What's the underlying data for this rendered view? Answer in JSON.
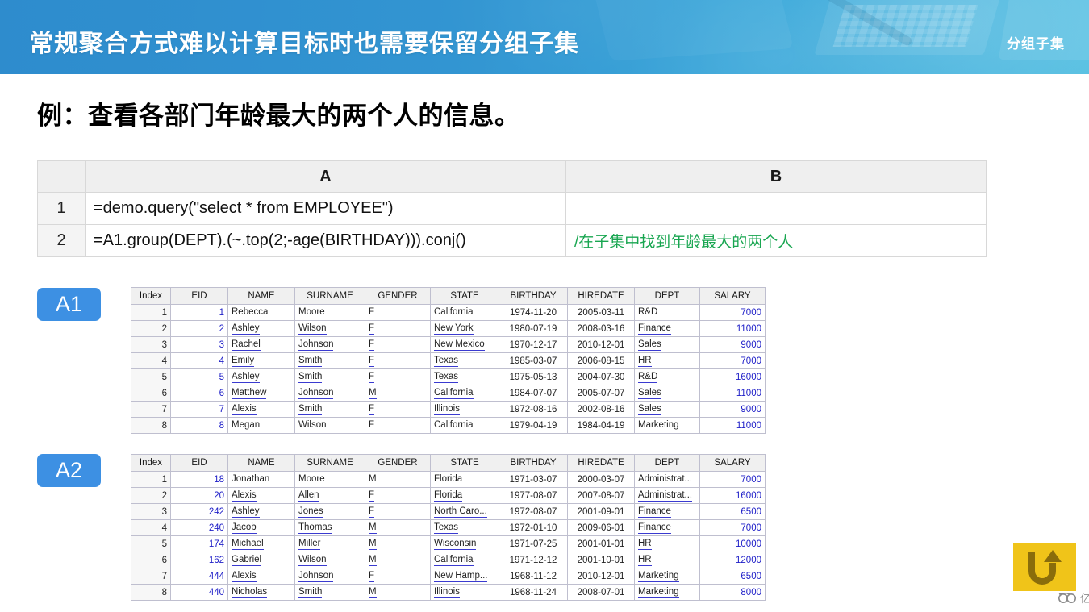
{
  "header": {
    "title": "常规聚合方式难以计算目标时也需要保留分组子集",
    "tag": "分组子集",
    "bg_color": "#2e92cf",
    "text_color": "#ffffff"
  },
  "subtitle": "例：查看各部门年龄最大的两个人的信息。",
  "code_table": {
    "corner_label": "",
    "columns": [
      "A",
      "B"
    ],
    "rows": [
      {
        "num": "1",
        "a": "=demo.query(\"select * from EMPLOYEE\")",
        "b": ""
      },
      {
        "num": "2",
        "a": "=A1.group(DEPT).(~.top(2;-age(BIRTHDAY))).conj()",
        "b": "/在子集中找到年龄最大的两个人"
      }
    ],
    "comment_color": "#19a651"
  },
  "results": [
    {
      "badge": "A1",
      "badge_color": "#3d90e3",
      "columns": [
        "Index",
        "EID",
        "NAME",
        "SURNAME",
        "GENDER",
        "STATE",
        "BIRTHDAY",
        "HIREDATE",
        "DEPT",
        "SALARY"
      ],
      "rows": [
        {
          "index": "1",
          "eid": "1",
          "name": "Rebecca",
          "surname": "Moore",
          "gender": "F",
          "state": "California",
          "birthday": "1974-11-20",
          "hiredate": "2005-03-11",
          "dept": "R&D",
          "salary": "7000"
        },
        {
          "index": "2",
          "eid": "2",
          "name": "Ashley",
          "surname": "Wilson",
          "gender": "F",
          "state": "New York",
          "birthday": "1980-07-19",
          "hiredate": "2008-03-16",
          "dept": "Finance",
          "salary": "11000"
        },
        {
          "index": "3",
          "eid": "3",
          "name": "Rachel",
          "surname": "Johnson",
          "gender": "F",
          "state": "New Mexico",
          "birthday": "1970-12-17",
          "hiredate": "2010-12-01",
          "dept": "Sales",
          "salary": "9000"
        },
        {
          "index": "4",
          "eid": "4",
          "name": "Emily",
          "surname": "Smith",
          "gender": "F",
          "state": "Texas",
          "birthday": "1985-03-07",
          "hiredate": "2006-08-15",
          "dept": "HR",
          "salary": "7000"
        },
        {
          "index": "5",
          "eid": "5",
          "name": "Ashley",
          "surname": "Smith",
          "gender": "F",
          "state": "Texas",
          "birthday": "1975-05-13",
          "hiredate": "2004-07-30",
          "dept": "R&D",
          "salary": "16000"
        },
        {
          "index": "6",
          "eid": "6",
          "name": "Matthew",
          "surname": "Johnson",
          "gender": "M",
          "state": "California",
          "birthday": "1984-07-07",
          "hiredate": "2005-07-07",
          "dept": "Sales",
          "salary": "11000"
        },
        {
          "index": "7",
          "eid": "7",
          "name": "Alexis",
          "surname": "Smith",
          "gender": "F",
          "state": "Illinois",
          "birthday": "1972-08-16",
          "hiredate": "2002-08-16",
          "dept": "Sales",
          "salary": "9000"
        },
        {
          "index": "8",
          "eid": "8",
          "name": "Megan",
          "surname": "Wilson",
          "gender": "F",
          "state": "California",
          "birthday": "1979-04-19",
          "hiredate": "1984-04-19",
          "dept": "Marketing",
          "salary": "11000"
        }
      ]
    },
    {
      "badge": "A2",
      "badge_color": "#3d90e3",
      "columns": [
        "Index",
        "EID",
        "NAME",
        "SURNAME",
        "GENDER",
        "STATE",
        "BIRTHDAY",
        "HIREDATE",
        "DEPT",
        "SALARY"
      ],
      "rows": [
        {
          "index": "1",
          "eid": "18",
          "name": "Jonathan",
          "surname": "Moore",
          "gender": "M",
          "state": "Florida",
          "birthday": "1971-03-07",
          "hiredate": "2000-03-07",
          "dept": "Administrat...",
          "salary": "7000"
        },
        {
          "index": "2",
          "eid": "20",
          "name": "Alexis",
          "surname": "Allen",
          "gender": "F",
          "state": "Florida",
          "birthday": "1977-08-07",
          "hiredate": "2007-08-07",
          "dept": "Administrat...",
          "salary": "16000"
        },
        {
          "index": "3",
          "eid": "242",
          "name": "Ashley",
          "surname": "Jones",
          "gender": "F",
          "state": "North Caro...",
          "birthday": "1972-08-07",
          "hiredate": "2001-09-01",
          "dept": "Finance",
          "salary": "6500"
        },
        {
          "index": "4",
          "eid": "240",
          "name": "Jacob",
          "surname": "Thomas",
          "gender": "M",
          "state": "Texas",
          "birthday": "1972-01-10",
          "hiredate": "2009-06-01",
          "dept": "Finance",
          "salary": "7000"
        },
        {
          "index": "5",
          "eid": "174",
          "name": "Michael",
          "surname": "Miller",
          "gender": "M",
          "state": "Wisconsin",
          "birthday": "1971-07-25",
          "hiredate": "2001-01-01",
          "dept": "HR",
          "salary": "10000"
        },
        {
          "index": "6",
          "eid": "162",
          "name": "Gabriel",
          "surname": "Wilson",
          "gender": "M",
          "state": "California",
          "birthday": "1971-12-12",
          "hiredate": "2001-10-01",
          "dept": "HR",
          "salary": "12000"
        },
        {
          "index": "7",
          "eid": "444",
          "name": "Alexis",
          "surname": "Johnson",
          "gender": "F",
          "state": "New Hamp...",
          "birthday": "1968-11-12",
          "hiredate": "2010-12-01",
          "dept": "Marketing",
          "salary": "6500"
        },
        {
          "index": "8",
          "eid": "440",
          "name": "Nicholas",
          "surname": "Smith",
          "gender": "M",
          "state": "Illinois",
          "birthday": "1968-11-24",
          "hiredate": "2008-07-01",
          "dept": "Marketing",
          "salary": "8000"
        }
      ]
    }
  ],
  "watermark": {
    "text": "亿速云",
    "square_color": "#f0c419",
    "logo_color": "#8a6d0b"
  }
}
